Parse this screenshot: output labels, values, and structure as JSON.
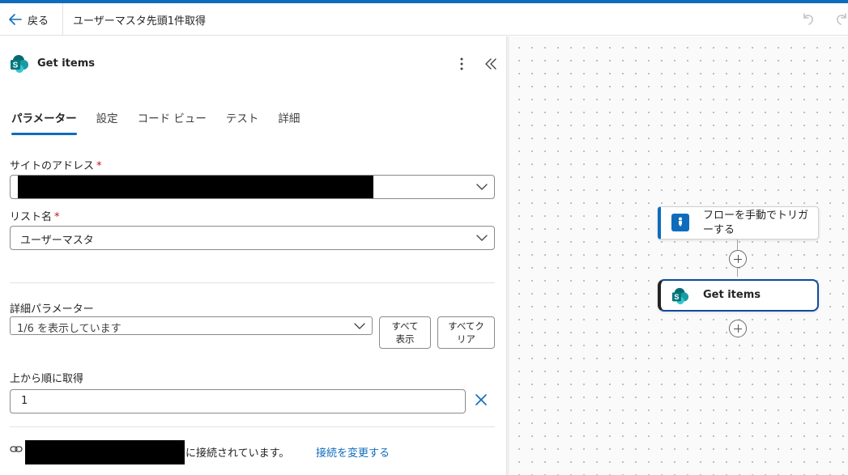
{
  "header": {
    "back_label": "戻る",
    "flow_title": "ユーザーマスタ先頭1件取得"
  },
  "panel": {
    "action_title": "Get items",
    "tabs": [
      {
        "label": "パラメーター",
        "active": true
      },
      {
        "label": "設定",
        "active": false
      },
      {
        "label": "コード ビュー",
        "active": false
      },
      {
        "label": "テスト",
        "active": false
      },
      {
        "label": "詳細",
        "active": false
      }
    ],
    "site_address": {
      "label": "サイトのアドレス",
      "required": "*",
      "value": ""
    },
    "list_name": {
      "label": "リスト名",
      "required": "*",
      "value": "ユーザーマスタ"
    },
    "advanced": {
      "label": "詳細パラメーター",
      "summary": "1/6 を表示しています",
      "show_all_line1": "すべて",
      "show_all_line2": "表示",
      "clear_all_line1": "すべてク",
      "clear_all_line2": "リア"
    },
    "top_count": {
      "label": "上から順に取得",
      "value": "1"
    },
    "connection": {
      "text": "に接続されています。",
      "change_link": "接続を変更する"
    }
  },
  "canvas": {
    "trigger_node": "フローを手動でトリガーする",
    "action_node": "Get items"
  },
  "colors": {
    "accent": "#0f6cbd",
    "required": "#c50f1f",
    "sharepoint_teal": "#038387"
  },
  "icons": [
    "back-arrow-icon",
    "undo-icon",
    "redo-icon",
    "sharepoint-icon",
    "more-vertical-icon",
    "collapse-icon",
    "chevron-down-icon",
    "close-icon",
    "link-icon",
    "manual-trigger-icon",
    "add-icon"
  ]
}
